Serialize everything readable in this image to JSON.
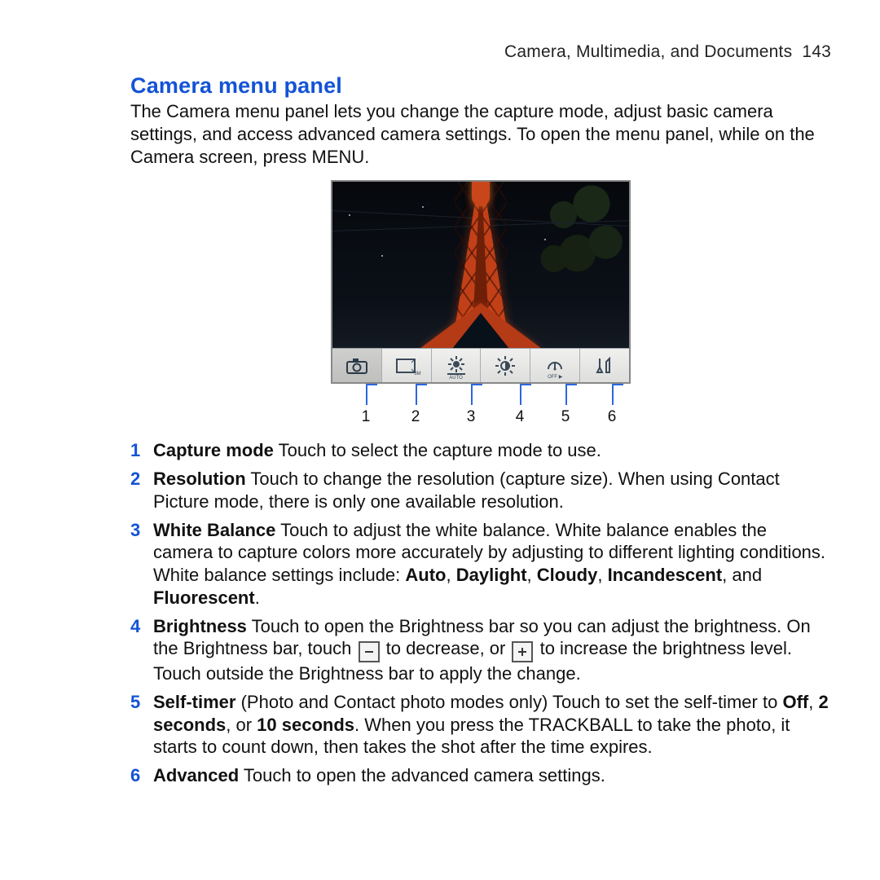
{
  "header": {
    "chapter": "Camera, Multimedia, and Documents",
    "page_no": "143"
  },
  "section": {
    "title": "Camera menu panel",
    "intro": "The Camera menu panel lets you change the capture mode, adjust basic camera settings, and access advanced camera settings. To open the menu panel, while on the Camera screen, press MENU."
  },
  "figure": {
    "menu_items": [
      {
        "name": "capture-mode-icon",
        "sub": ""
      },
      {
        "name": "resolution-icon",
        "sub": "3M"
      },
      {
        "name": "white-balance-icon",
        "sub": "AUTO"
      },
      {
        "name": "brightness-icon",
        "sub": ""
      },
      {
        "name": "self-timer-icon",
        "sub": "OFF ▶"
      },
      {
        "name": "advanced-icon",
        "sub": ""
      }
    ],
    "callouts": [
      "1",
      "2",
      "3",
      "4",
      "5",
      "6"
    ]
  },
  "items": [
    {
      "num": "1",
      "title": "Capture mode",
      "segments": [
        {
          "t": "  Touch to select the capture mode to use."
        }
      ]
    },
    {
      "num": "2",
      "title": "Resolution",
      "segments": [
        {
          "t": "  Touch to change the resolution (capture size). When using Contact Picture mode, there is only one available resolution."
        }
      ]
    },
    {
      "num": "3",
      "title": "White Balance",
      "segments": [
        {
          "t": "  Touch to adjust the white balance. White balance enables the camera to capture colors more accurately by adjusting to different lighting conditions. White balance settings include: "
        },
        {
          "t": "Auto",
          "b": true
        },
        {
          "t": ", "
        },
        {
          "t": "Daylight",
          "b": true
        },
        {
          "t": ", "
        },
        {
          "t": "Cloudy",
          "b": true
        },
        {
          "t": ", "
        },
        {
          "t": "Incandescent",
          "b": true
        },
        {
          "t": ", and "
        },
        {
          "t": "Fluorescent",
          "b": true
        },
        {
          "t": "."
        }
      ]
    },
    {
      "num": "4",
      "title": "Brightness",
      "segments": [
        {
          "t": "  Touch to open the Brightness bar so you can adjust the brightness. On the Brightness bar, touch "
        },
        {
          "btn": "minus"
        },
        {
          "t": " to decrease, or "
        },
        {
          "btn": "plus"
        },
        {
          "t": " to increase the brightness level. Touch outside the Brightness bar to apply the change."
        }
      ]
    },
    {
      "num": "5",
      "title": "Self-timer",
      "segments": [
        {
          "t": " (Photo and Contact photo modes only)  Touch to set the self-timer to "
        },
        {
          "t": "Off",
          "b": true
        },
        {
          "t": ", "
        },
        {
          "t": "2 seconds",
          "b": true
        },
        {
          "t": ", or "
        },
        {
          "t": "10 seconds",
          "b": true
        },
        {
          "t": ". When you press the TRACKBALL to take the photo, it starts to count down, then takes the shot after the time expires."
        }
      ]
    },
    {
      "num": "6",
      "title": "Advanced",
      "segments": [
        {
          "t": "  Touch to open the advanced camera settings."
        }
      ]
    }
  ]
}
